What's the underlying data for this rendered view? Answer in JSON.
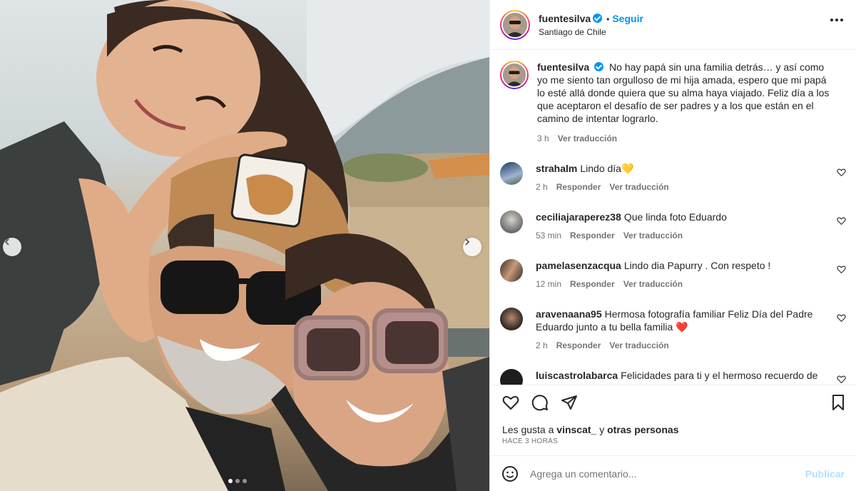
{
  "post": {
    "username": "fuentesilva",
    "follow_label": "Seguir",
    "separator": "•",
    "location": "Santiago de Chile",
    "caption": "No hay papá sin una familia detrás… y así como yo me siento tan orgulloso de mi hija amada, espero que mi papá lo esté allá donde quiera que su alma haya viajado. Feliz día a los que aceptaron el desafío de ser padres y a los que están en el camino de intentar lograrlo.",
    "caption_time": "3 h",
    "translate_label": "Ver traducción"
  },
  "comments": [
    {
      "username": "strahalm",
      "text": "Lindo día",
      "emoji": "💛",
      "time": "2 h",
      "reply": "Responder",
      "translate": "Ver traducción"
    },
    {
      "username": "ceciliajaraperez38",
      "text": "Que linda foto Eduardo",
      "time": "53 min",
      "reply": "Responder",
      "translate": "Ver traducción"
    },
    {
      "username": "pamelasenzacqua",
      "text": "Lindo dia Papurry . Con respeto !",
      "time": "12 min",
      "reply": "Responder",
      "translate": "Ver traducción"
    },
    {
      "username": "aravenaana95",
      "text": "Hermosa fotografía familiar Feliz Día del Padre Eduardo junto a tu bella familia",
      "emoji": "❤️",
      "time": "2 h",
      "reply": "Responder",
      "translate": "Ver traducción"
    },
    {
      "username": "luiscastrolabarca",
      "text": "Felicidades para ti y el hermoso recuerdo de"
    }
  ],
  "likes": {
    "prefix": "Les gusta a",
    "user": "vinscat_",
    "joiner": "y",
    "others": "otras personas"
  },
  "posted_ago": "HACE 3 HORAS",
  "add_comment": {
    "placeholder": "Agrega un comentario...",
    "publish_label": "Publicar"
  },
  "carousel": {
    "slides": 3,
    "active_slide": 1
  },
  "colors": {
    "accent": "#0095f6",
    "publish_disabled": "#b2dffc",
    "muted": "#737373"
  },
  "icons": [
    "chevron-left-icon",
    "chevron-right-icon",
    "more-icon",
    "heart-icon",
    "comment-icon",
    "share-icon",
    "bookmark-icon",
    "emoji-icon",
    "verified-icon"
  ]
}
